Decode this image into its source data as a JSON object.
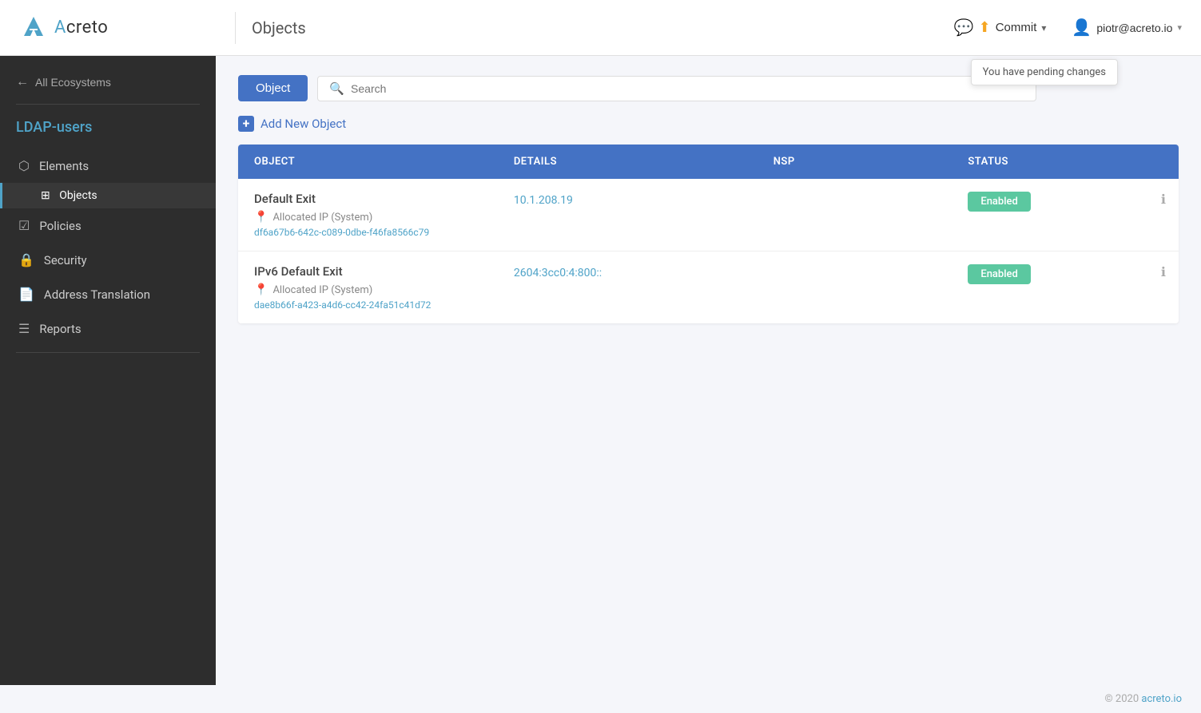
{
  "header": {
    "title": "Objects",
    "commit_label": "Commit",
    "pending_label": "You have pending changes",
    "user_email": "piotr@acreto.io"
  },
  "logo": {
    "text_plain": "creto",
    "text_accent": "A",
    "full": "Acreto"
  },
  "sidebar": {
    "back_label": "All Ecosystems",
    "ecosystem_name_plain": "DAP-users",
    "ecosystem_name_accent": "L",
    "items": [
      {
        "id": "elements",
        "label": "Elements",
        "icon": "⬡"
      },
      {
        "id": "objects",
        "label": "Objects",
        "icon": "⊞",
        "sub": true
      },
      {
        "id": "policies",
        "label": "Policies",
        "icon": "☑"
      },
      {
        "id": "security",
        "label": "Security",
        "icon": "🔒"
      },
      {
        "id": "address-translation",
        "label": "Address Translation",
        "icon": "📄"
      },
      {
        "id": "reports",
        "label": "Reports",
        "icon": "☰"
      }
    ]
  },
  "filter": {
    "button_label": "Object",
    "search_placeholder": "Search"
  },
  "add_new": {
    "label": "Add New Object"
  },
  "table": {
    "columns": [
      "OBJECT",
      "DETAILS",
      "NSP",
      "STATUS"
    ],
    "rows": [
      {
        "name": "Default Exit",
        "detail_ip": "10.1.208.19",
        "sub_label": "Allocated IP (System)",
        "id_hash": "df6a67b6-642c-c089-0dbe-f46fa8566c79",
        "nsp": "",
        "status": "Enabled"
      },
      {
        "name": "IPv6 Default Exit",
        "detail_ip": "2604:3cc0:4:800::",
        "sub_label": "Allocated IP (System)",
        "id_hash": "dae8b66f-a423-a4d6-cc42-24fa51c41d72",
        "nsp": "",
        "status": "Enabled"
      }
    ]
  },
  "footer": {
    "copy": "© 2020",
    "link_text": "acreto.io",
    "link_url": "#"
  }
}
